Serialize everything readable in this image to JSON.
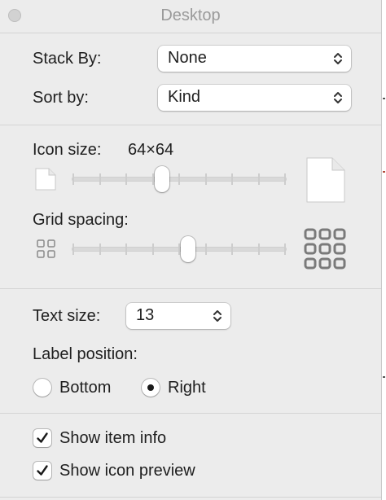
{
  "window": {
    "title": "Desktop"
  },
  "stack_by": {
    "label": "Stack By:",
    "value": "None"
  },
  "sort_by": {
    "label": "Sort by:",
    "value": "Kind"
  },
  "icon_size": {
    "label": "Icon size:",
    "value": "64×64",
    "slider_fraction": 0.42
  },
  "grid_spacing": {
    "label": "Grid spacing:",
    "slider_fraction": 0.54
  },
  "text_size": {
    "label": "Text size:",
    "value": "13"
  },
  "label_position": {
    "label": "Label position:",
    "options": [
      "Bottom",
      "Right"
    ],
    "selected": "Right"
  },
  "checkboxes": [
    {
      "label": "Show item info",
      "checked": true
    },
    {
      "label": "Show icon preview",
      "checked": true
    }
  ],
  "icons": {
    "small_doc": "small-document-icon",
    "large_doc": "large-document-icon",
    "small_grid": "small-grid-icon",
    "large_grid": "large-grid-icon"
  }
}
